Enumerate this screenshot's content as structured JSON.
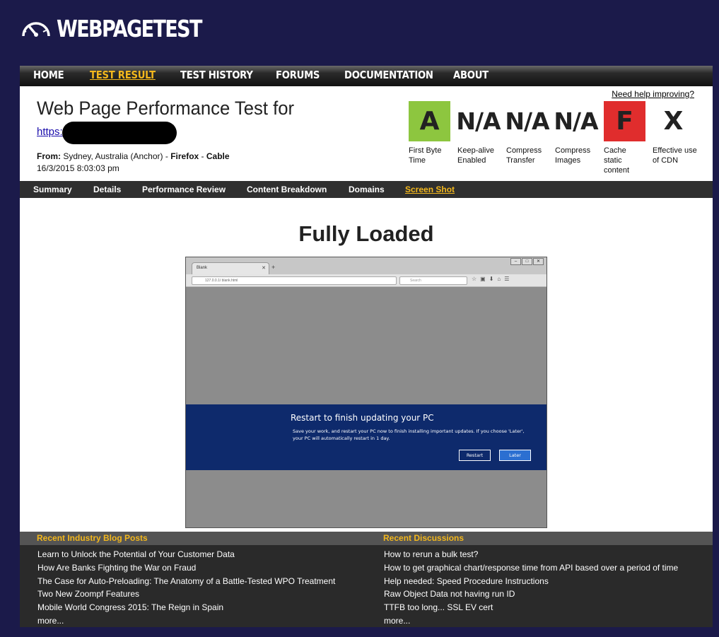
{
  "logo": {
    "text": "WEBPAGETEST",
    "icon": "speedometer-icon"
  },
  "topnav": [
    {
      "label": "HOME",
      "active": false
    },
    {
      "label": "TEST RESULT",
      "active": true
    },
    {
      "label": "TEST HISTORY",
      "active": false
    },
    {
      "label": "FORUMS",
      "active": false
    },
    {
      "label": "DOCUMENTATION",
      "active": false
    },
    {
      "label": "ABOUT",
      "active": false
    }
  ],
  "header": {
    "title": "Web Page Performance Test for",
    "url": "https:/",
    "from_label": "From:",
    "location": "Sydney, Australia (Anchor)",
    "browser": "Firefox",
    "connection": "Cable",
    "sep": " - ",
    "date": "16/3/2015 8:03:03 pm",
    "help_link": "Need help improving?"
  },
  "grades": [
    {
      "value": "A",
      "label": "First Byte Time",
      "color": "#8dc63f"
    },
    {
      "value": "N/A",
      "label": "Keep-alive Enabled",
      "color": "#ffffff"
    },
    {
      "value": "N/A",
      "label": "Compress Transfer",
      "color": "#ffffff"
    },
    {
      "value": "N/A",
      "label": "Compress Images",
      "color": "#ffffff"
    },
    {
      "value": "F",
      "label": "Cache static content",
      "color": "#e02d2d"
    },
    {
      "value": "X",
      "label": "Effective use of CDN",
      "color": "#ffffff"
    }
  ],
  "subnav": [
    {
      "label": "Summary",
      "active": false
    },
    {
      "label": "Details",
      "active": false
    },
    {
      "label": "Performance Review",
      "active": false
    },
    {
      "label": "Content Breakdown",
      "active": false
    },
    {
      "label": "Domains",
      "active": false
    },
    {
      "label": "Screen Shot",
      "active": true
    }
  ],
  "main": {
    "title": "Fully Loaded",
    "screenshot": {
      "tab_label": "Blank",
      "url_text": "127.0.0.1/ blank.html",
      "search_placeholder": "Search",
      "dialog_title": "Restart to finish updating your PC",
      "dialog_body": "Save your work, and restart your PC now to finish installing important updates. If you choose 'Later', your PC will automatically restart in 1 day.",
      "restart_label": "Restart",
      "later_label": "Later"
    }
  },
  "footer": {
    "blog_heading": "Recent Industry Blog Posts",
    "discussions_heading": "Recent Discussions",
    "blog_posts": [
      "Learn to Unlock the Potential of Your Customer Data",
      "How Are Banks Fighting the War on Fraud",
      "The Case for Auto-Preloading: The Anatomy of a Battle-Tested WPO Treatment",
      "Two New Zoompf Features",
      "Mobile World Congress 2015: The Reign in Spain",
      "more..."
    ],
    "discussions": [
      "How to rerun a bulk test?",
      "How to get graphical chart/response time from API based over a period of time",
      "Help needed: Speed Procedure Instructions",
      "Raw Object Data not having run ID",
      "TTFB too long... SSL EV cert",
      "more..."
    ]
  }
}
